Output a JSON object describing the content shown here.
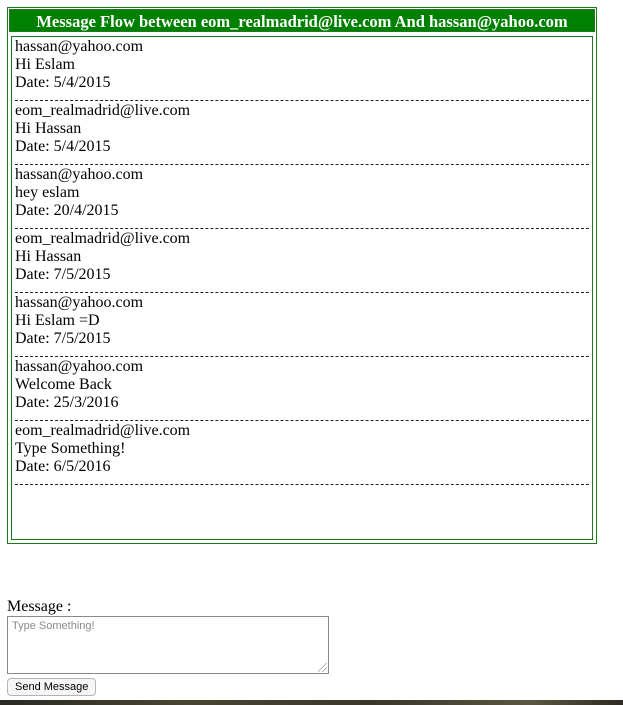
{
  "header": {
    "title": "Message Flow between eom_realmadrid@live.com And hassan@yahoo.com"
  },
  "messages": [
    {
      "sender": "hassan@yahoo.com",
      "text": "Hi Eslam",
      "date": "Date: 5/4/2015"
    },
    {
      "sender": "eom_realmadrid@live.com",
      "text": "Hi Hassan",
      "date": "Date: 5/4/2015"
    },
    {
      "sender": "hassan@yahoo.com",
      "text": "hey eslam",
      "date": "Date: 20/4/2015"
    },
    {
      "sender": "eom_realmadrid@live.com",
      "text": "Hi Hassan",
      "date": "Date: 7/5/2015"
    },
    {
      "sender": "hassan@yahoo.com",
      "text": "Hi Eslam =D",
      "date": "Date: 7/5/2015"
    },
    {
      "sender": "hassan@yahoo.com",
      "text": "Welcome Back",
      "date": "Date: 25/3/2016"
    },
    {
      "sender": "eom_realmadrid@live.com",
      "text": "Type Something!",
      "date": "Date: 6/5/2016"
    }
  ],
  "form": {
    "label": "Message :",
    "placeholder": "Type Something!",
    "value": "",
    "send_label": "Send Message"
  },
  "colors": {
    "header_bg": "#008000",
    "header_text": "#ffffff",
    "border": "#1f7a1f"
  }
}
